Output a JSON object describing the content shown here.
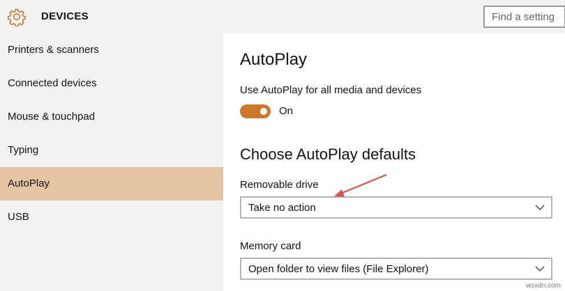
{
  "header": {
    "title": "DEVICES",
    "search_placeholder": "Find a setting",
    "icon": "gear-icon"
  },
  "sidebar": {
    "items": [
      {
        "label": "Printers & scanners",
        "active": false
      },
      {
        "label": "Connected devices",
        "active": false
      },
      {
        "label": "Mouse & touchpad",
        "active": false
      },
      {
        "label": "Typing",
        "active": false
      },
      {
        "label": "AutoPlay",
        "active": true
      },
      {
        "label": "USB",
        "active": false
      }
    ]
  },
  "main": {
    "title": "AutoPlay",
    "autoplay_toggle": {
      "label": "Use AutoPlay for all media and devices",
      "state_text": "On",
      "on": true
    },
    "defaults_heading": "Choose AutoPlay defaults",
    "fields": [
      {
        "label": "Removable drive",
        "value": "Take no action"
      },
      {
        "label": "Memory card",
        "value": "Open folder to view files (File Explorer)"
      }
    ]
  },
  "colors": {
    "accent": "#cc7a2a",
    "active_nav": "#e6c6a2",
    "sidebar_bg": "#f2f2f2",
    "annotation_arrow": "#d9534f"
  },
  "watermark": "wsxdn.com"
}
